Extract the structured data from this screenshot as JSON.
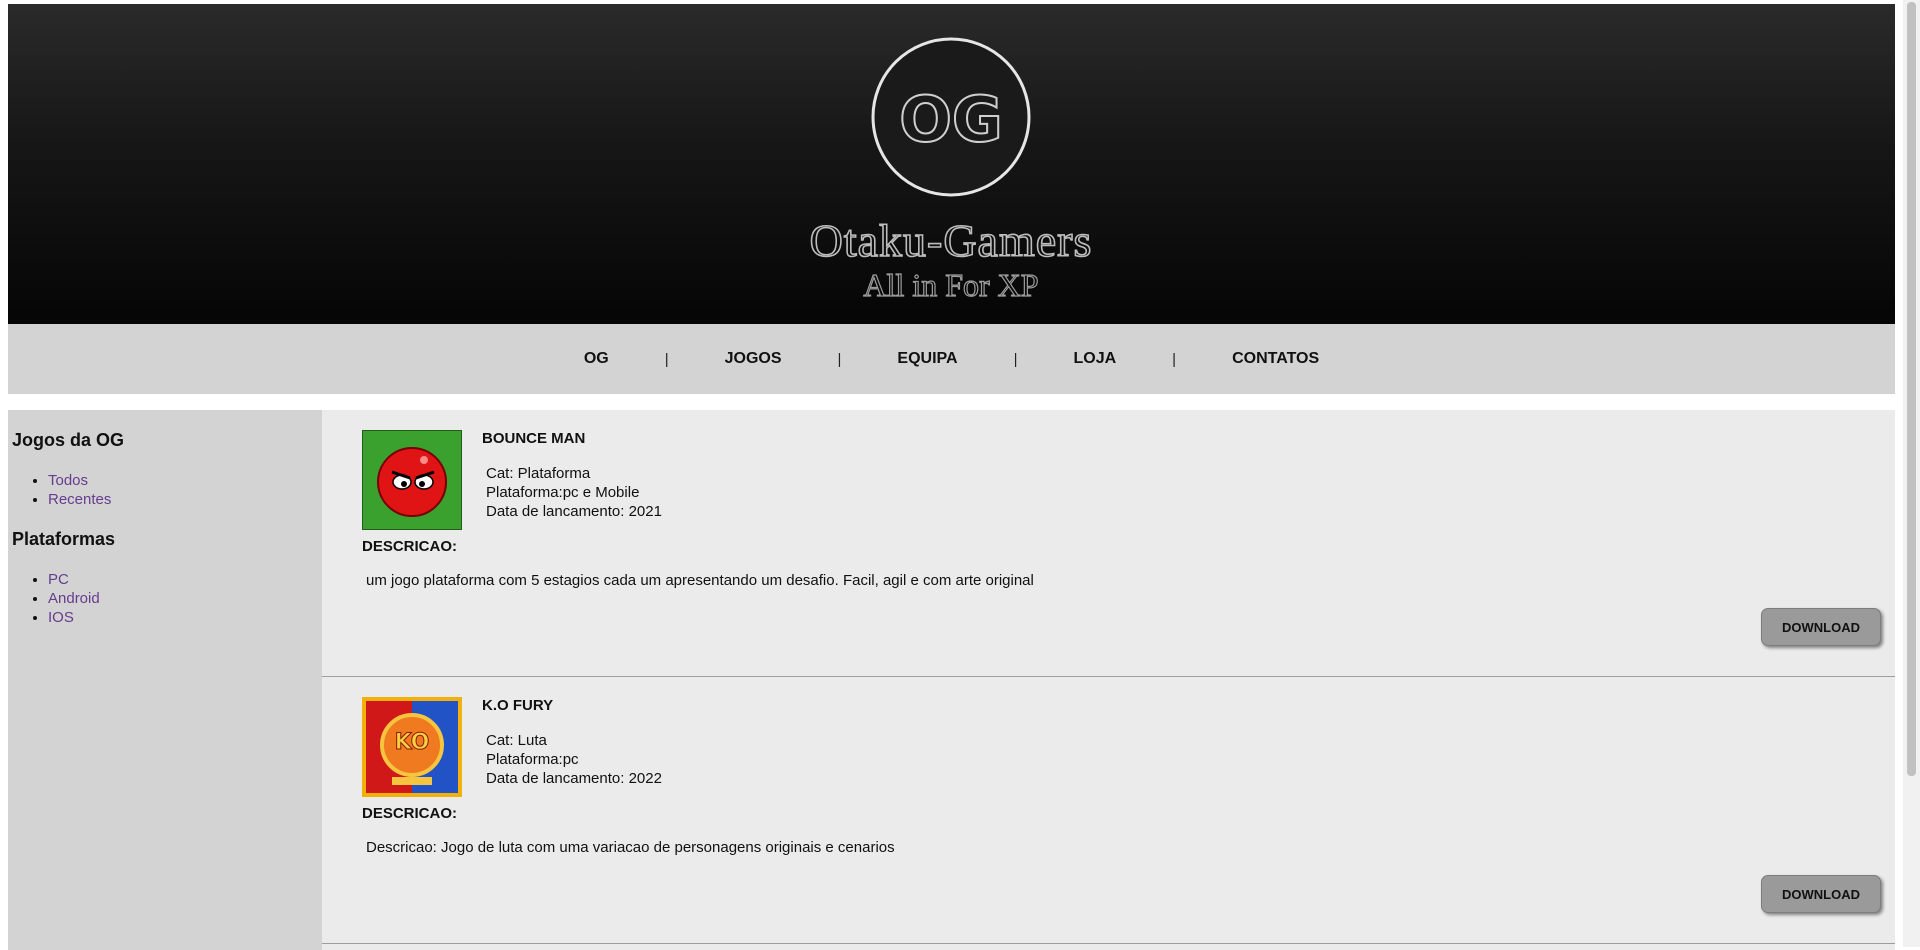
{
  "header": {
    "logo_monogram": "OG",
    "logo_name": "Otaku-Gamers",
    "logo_tagline": "All in For XP"
  },
  "nav": {
    "items": [
      "OG",
      "JOGOS",
      "EQUIPA",
      "LOJA",
      "CONTATOS"
    ],
    "separator": "|"
  },
  "sidebar": {
    "section1_title": "Jogos da OG",
    "section1_items": [
      "Todos",
      "Recentes"
    ],
    "section2_title": "Plataformas",
    "section2_items": [
      "PC",
      "Android",
      "IOS"
    ],
    "link_color": "#663c8e"
  },
  "games": [
    {
      "title": "BOUNCE MAN",
      "category": "Cat: Plataforma",
      "platform": "Plataforma:pc e Mobile",
      "release": "Data de lancamento: 2021",
      "desc_label": "DESCRICAO:",
      "description": "um jogo plataforma com 5 estagios cada um apresentando um desafio. Facil, agil e com arte original",
      "button": "DOWNLOAD",
      "thumb_icon": "red-ball-character-icon"
    },
    {
      "title": "K.O FURY",
      "category": "Cat: Luta",
      "platform": "Plataforma:pc",
      "release": "Data de lancamento: 2022",
      "desc_label": "DESCRICAO:",
      "description": "Descricao: Jogo de luta com uma variacao de personagens originais e cenarios",
      "button": "DOWNLOAD",
      "thumb_icon": "ko-fury-emblem-icon"
    }
  ]
}
